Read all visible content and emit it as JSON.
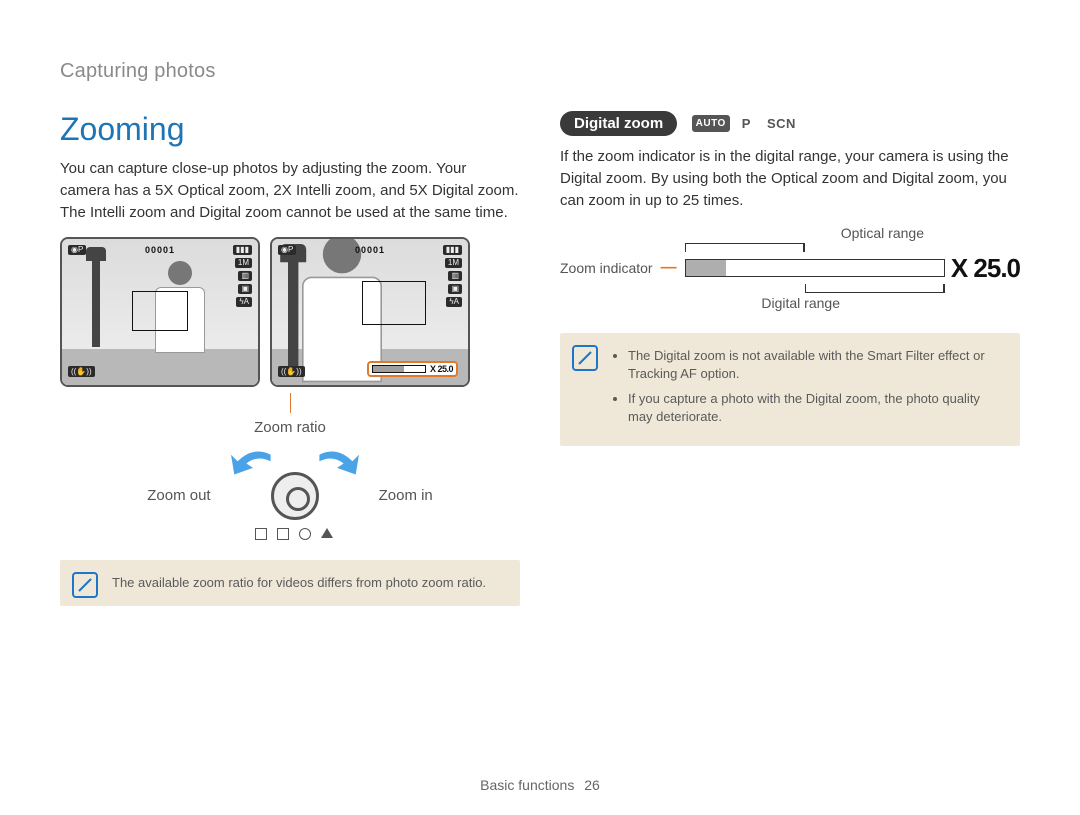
{
  "chapter": "Capturing photos",
  "section_title": "Zooming",
  "intro_paragraph": "You can capture close-up photos by adjusting the zoom. Your camera has a 5X Optical zoom, 2X Intelli zoom, and 5X Digital zoom. The Intelli zoom and Digital zoom cannot be used at the same time.",
  "screens": {
    "counter": "00001",
    "zoom_value": "X 25.0"
  },
  "labels": {
    "zoom_ratio": "Zoom ratio",
    "zoom_out": "Zoom out",
    "zoom_in": "Zoom in"
  },
  "note_left": "The available zoom ratio for videos differs from photo zoom ratio.",
  "right": {
    "pill": "Digital zoom",
    "modes": {
      "auto": "AUTO",
      "p": "P",
      "scn": "SCN"
    },
    "paragraph": "If the zoom indicator is in the digital range, your camera is using the Digital zoom. By using both the Optical zoom and Digital zoom, you can zoom in up to 25 times.",
    "range": {
      "optical": "Optical range",
      "indicator": "Zoom indicator",
      "digital": "Digital range",
      "value": "X 25.0"
    },
    "notes": [
      "The Digital zoom is not available with the Smart Filter effect or Tracking AF option.",
      "If you capture a photo with the Digital zoom, the photo quality may deteriorate."
    ]
  },
  "footer": {
    "section": "Basic functions",
    "page": "26"
  }
}
